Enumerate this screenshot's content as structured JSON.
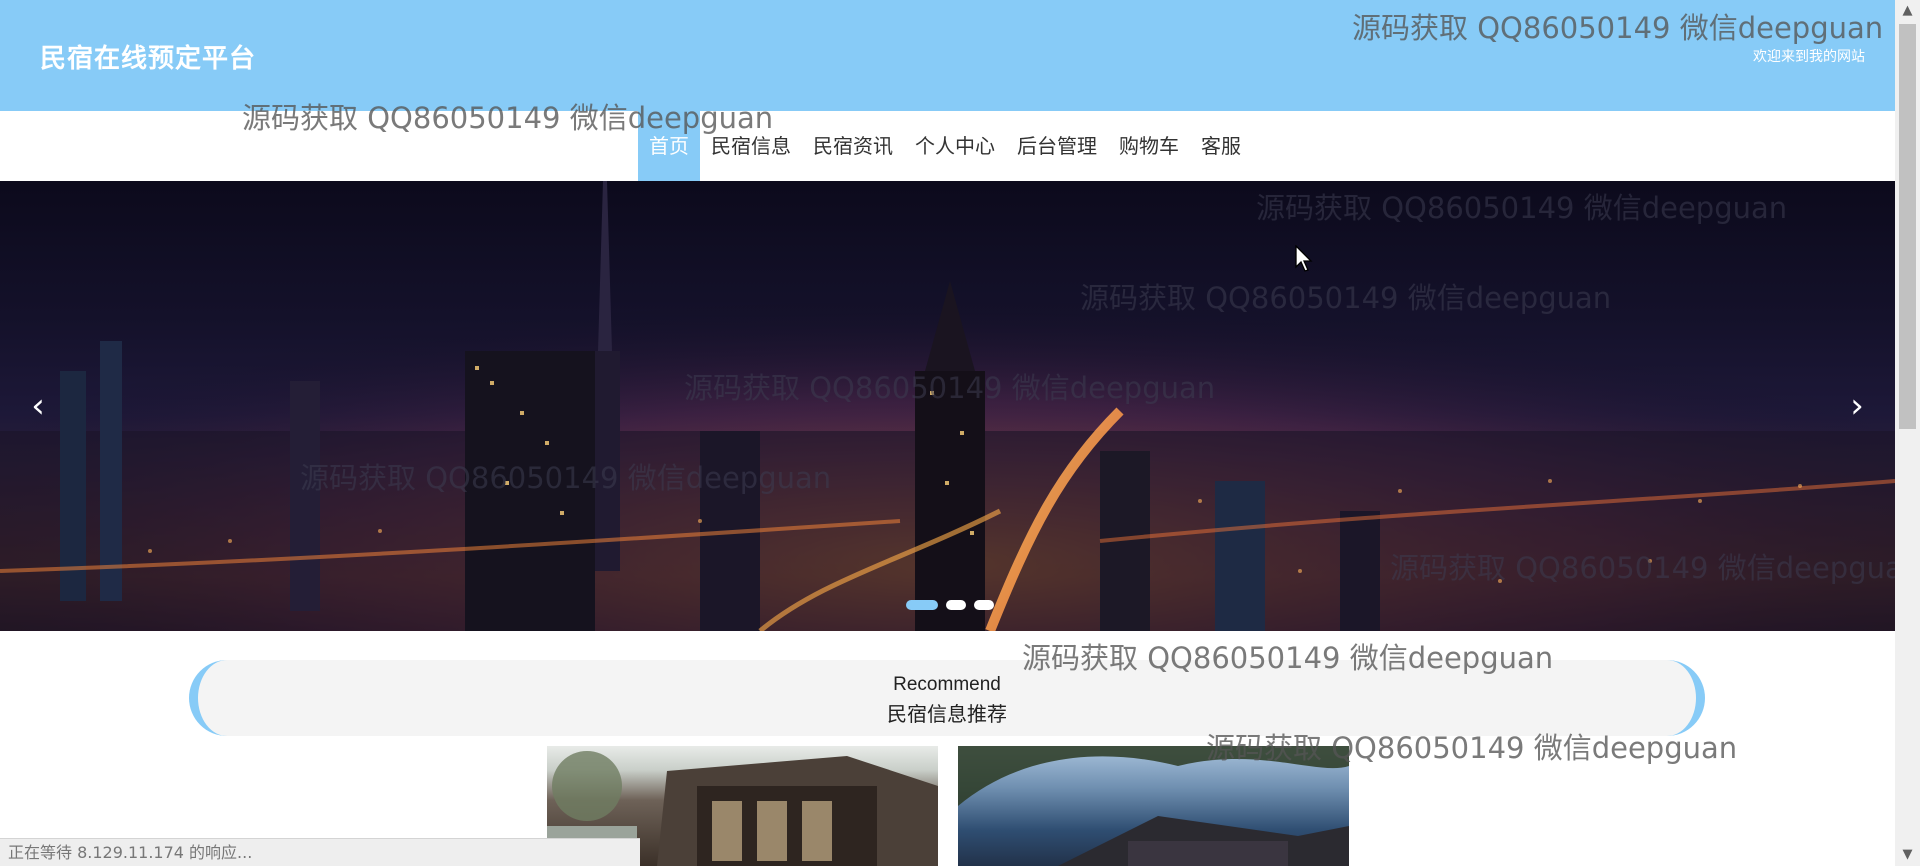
{
  "header": {
    "site_title": "民宿在线预定平台",
    "welcome": "欢迎来到我的网站"
  },
  "nav": {
    "items": [
      {
        "label": "首页",
        "active": true
      },
      {
        "label": "民宿信息"
      },
      {
        "label": "民宿资讯"
      },
      {
        "label": "个人中心"
      },
      {
        "label": "后台管理"
      },
      {
        "label": "购物车"
      },
      {
        "label": "客服"
      }
    ]
  },
  "banner": {
    "prev_arrow": "‹",
    "next_arrow": "›",
    "slide_count": 3,
    "active_slide": 1
  },
  "recommend": {
    "title_en": "Recommend",
    "title_cn": "民宿信息推荐"
  },
  "status_bar": {
    "text": "正在等待 8.129.11.174 的响应..."
  },
  "watermark": {
    "text": "源码获取 QQ86050149 微信deepguan"
  },
  "icons": {
    "scroll_up": "▲",
    "scroll_down": "▼"
  },
  "colors": {
    "accent": "#87cbf7",
    "header_text": "#ffffff",
    "nav_text": "#333333"
  }
}
